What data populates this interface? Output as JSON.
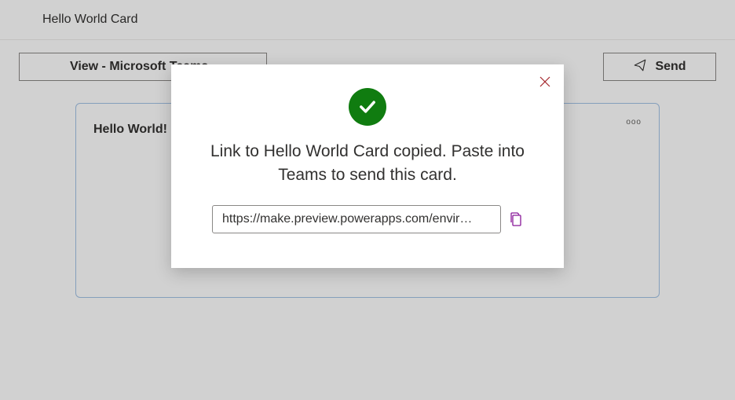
{
  "header": {
    "title": "Hello World Card"
  },
  "toolbar": {
    "view_label": "View - Microsoft Teams -",
    "send_label": "Send"
  },
  "card": {
    "title": "Hello World!",
    "menu_glyph": "ooo"
  },
  "modal": {
    "message": "Link to Hello World Card copied. Paste into Teams to send this card.",
    "url": "https://make.preview.powerapps.com/envir…"
  }
}
